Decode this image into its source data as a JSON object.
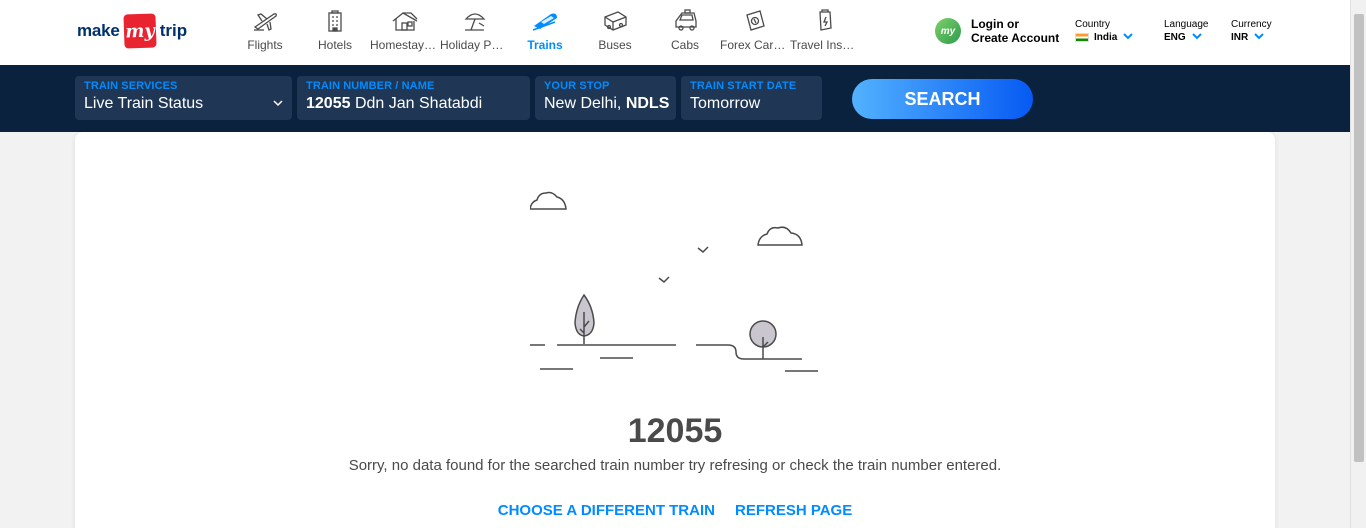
{
  "brand": {
    "make": "make",
    "my": "my",
    "trip": "trip"
  },
  "nav": [
    {
      "label": "Flights",
      "icon": "flight-icon",
      "active": false
    },
    {
      "label": "Hotels",
      "icon": "hotel-icon",
      "active": false
    },
    {
      "label": "Homestays & Villas",
      "icon": "homestay-icon",
      "active": false
    },
    {
      "label": "Holiday Packages",
      "icon": "holiday-icon",
      "active": false
    },
    {
      "label": "Trains",
      "icon": "train-icon",
      "active": true
    },
    {
      "label": "Buses",
      "icon": "bus-icon",
      "active": false
    },
    {
      "label": "Cabs",
      "icon": "cab-icon",
      "active": false
    },
    {
      "label": "Forex Card & Currency",
      "icon": "forex-icon",
      "active": false
    },
    {
      "label": "Travel Insurance",
      "icon": "insurance-icon",
      "active": false
    }
  ],
  "account": {
    "line1": "Login or",
    "line2": "Create Account",
    "avatar_text": "my"
  },
  "country": {
    "label": "Country",
    "value": "India"
  },
  "language": {
    "label": "Language",
    "value": "ENG"
  },
  "currency": {
    "label": "Currency",
    "value": "INR"
  },
  "search": {
    "service_label": "TRAIN SERVICES",
    "service_value": "Live Train Status",
    "train_label": "TRAIN NUMBER / NAME",
    "train_number": "12055",
    "train_name": "Ddn Jan Shatabdi",
    "stop_label": "YOUR STOP",
    "stop_city": "New Delhi,",
    "stop_code": "NDLS",
    "date_label": "TRAIN START DATE",
    "date_value": "Tomorrow",
    "button": "SEARCH"
  },
  "result": {
    "train_number": "12055",
    "message": "Sorry, no data found for the searched train number try refresing or check the train number entered.",
    "choose_link": "CHOOSE A DIFFERENT TRAIN",
    "refresh_link": "REFRESH PAGE"
  },
  "colors": {
    "accent": "#008cff",
    "navy": "#0a223d",
    "field": "#1f3654",
    "brand_red": "#ea2330"
  }
}
